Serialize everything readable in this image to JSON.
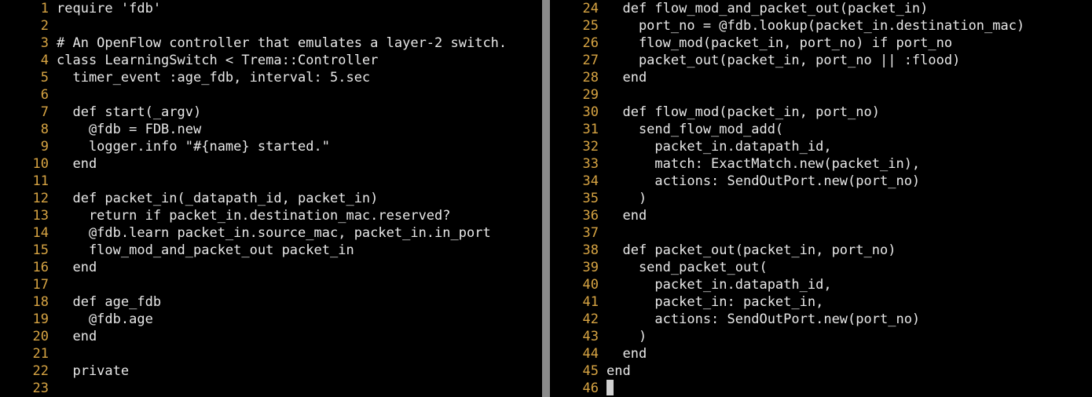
{
  "editor": {
    "left_pane": {
      "lines": [
        {
          "number": "1",
          "code": "require 'fdb'"
        },
        {
          "number": "2",
          "code": ""
        },
        {
          "number": "3",
          "code": "# An OpenFlow controller that emulates a layer-2 switch."
        },
        {
          "number": "4",
          "code": "class LearningSwitch < Trema::Controller"
        },
        {
          "number": "5",
          "code": "  timer_event :age_fdb, interval: 5.sec"
        },
        {
          "number": "6",
          "code": ""
        },
        {
          "number": "7",
          "code": "  def start(_argv)"
        },
        {
          "number": "8",
          "code": "    @fdb = FDB.new"
        },
        {
          "number": "9",
          "code": "    logger.info \"#{name} started.\""
        },
        {
          "number": "10",
          "code": "  end"
        },
        {
          "number": "11",
          "code": ""
        },
        {
          "number": "12",
          "code": "  def packet_in(_datapath_id, packet_in)"
        },
        {
          "number": "13",
          "code": "    return if packet_in.destination_mac.reserved?"
        },
        {
          "number": "14",
          "code": "    @fdb.learn packet_in.source_mac, packet_in.in_port"
        },
        {
          "number": "15",
          "code": "    flow_mod_and_packet_out packet_in"
        },
        {
          "number": "16",
          "code": "  end"
        },
        {
          "number": "17",
          "code": ""
        },
        {
          "number": "18",
          "code": "  def age_fdb"
        },
        {
          "number": "19",
          "code": "    @fdb.age"
        },
        {
          "number": "20",
          "code": "  end"
        },
        {
          "number": "21",
          "code": ""
        },
        {
          "number": "22",
          "code": "  private"
        },
        {
          "number": "23",
          "code": ""
        }
      ]
    },
    "right_pane": {
      "lines": [
        {
          "number": "24",
          "code": "  def flow_mod_and_packet_out(packet_in)"
        },
        {
          "number": "25",
          "code": "    port_no = @fdb.lookup(packet_in.destination_mac)"
        },
        {
          "number": "26",
          "code": "    flow_mod(packet_in, port_no) if port_no"
        },
        {
          "number": "27",
          "code": "    packet_out(packet_in, port_no || :flood)"
        },
        {
          "number": "28",
          "code": "  end"
        },
        {
          "number": "29",
          "code": ""
        },
        {
          "number": "30",
          "code": "  def flow_mod(packet_in, port_no)"
        },
        {
          "number": "31",
          "code": "    send_flow_mod_add("
        },
        {
          "number": "32",
          "code": "      packet_in.datapath_id,"
        },
        {
          "number": "33",
          "code": "      match: ExactMatch.new(packet_in),"
        },
        {
          "number": "34",
          "code": "      actions: SendOutPort.new(port_no)"
        },
        {
          "number": "35",
          "code": "    )"
        },
        {
          "number": "36",
          "code": "  end"
        },
        {
          "number": "37",
          "code": ""
        },
        {
          "number": "38",
          "code": "  def packet_out(packet_in, port_no)"
        },
        {
          "number": "39",
          "code": "    send_packet_out("
        },
        {
          "number": "40",
          "code": "      packet_in.datapath_id,"
        },
        {
          "number": "41",
          "code": "      packet_in: packet_in,"
        },
        {
          "number": "42",
          "code": "      actions: SendOutPort.new(port_no)"
        },
        {
          "number": "43",
          "code": "    )"
        },
        {
          "number": "44",
          "code": "  end"
        },
        {
          "number": "45",
          "code": "end"
        },
        {
          "number": "46",
          "code": ""
        }
      ]
    },
    "colors": {
      "background": "#000000",
      "line_number": "#d7a443",
      "code_text": "#e8e8e8",
      "divider": "#8a8a8a",
      "cursor": "#d0d0d0"
    }
  }
}
